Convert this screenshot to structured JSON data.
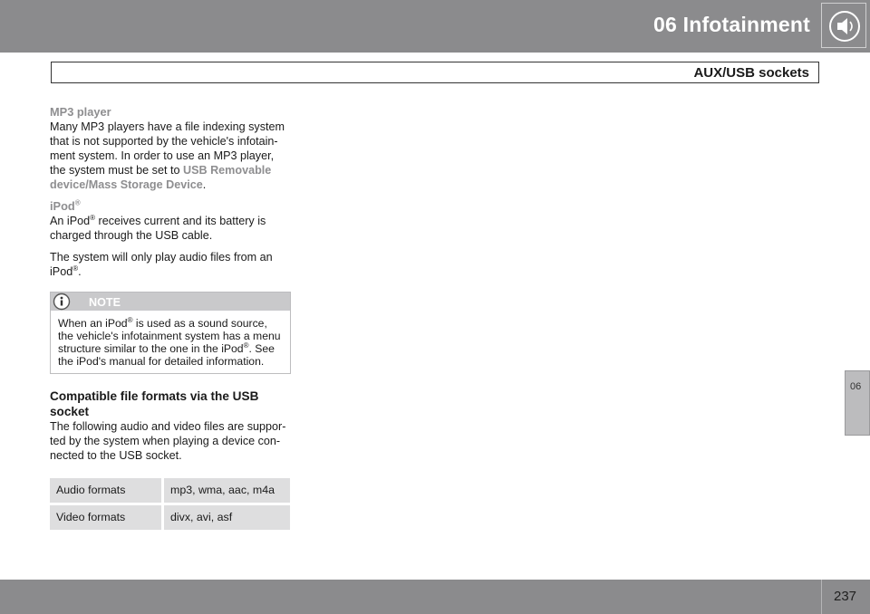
{
  "header": {
    "chapter_title": "06  Infotainment",
    "section_title": "AUX/USB sockets"
  },
  "mp3": {
    "heading": "MP3 player",
    "text_1": "Many MP3 players have a file indexing system that is not supported by the vehicle's infotain-ment system. In order to use an MP3 player, the system must be set to ",
    "link": "USB Removable device/Mass Storage Device",
    "text_2": "."
  },
  "ipod": {
    "heading": "iPod",
    "reg": "®",
    "p1_a": "An iPod",
    "p1_b": " receives current and its battery is charged through the USB cable.",
    "p2_a": "The system will only play audio files from an iPod",
    "p2_b": "."
  },
  "note": {
    "label": "NOTE",
    "text_a": "When an iPod",
    "text_b": " is used as a sound source, the vehicle's infotainment system has a menu structure similar to the one in the iPod",
    "text_c": ". See the iPod's manual for detailed information."
  },
  "compat": {
    "heading": "Compatible file formats via the USB socket",
    "text": "The following audio and video files are suppor-ted by the system when playing a device con-nected to the USB socket."
  },
  "formats": [
    {
      "label": "Audio formats",
      "value": "mp3, wma, aac, m4a"
    },
    {
      "label": "Video formats",
      "value": "divx, avi, asf"
    }
  ],
  "side_tab": "06",
  "page_number": "237",
  "icons": {
    "header_icon": "speaker-icon",
    "note_icon": "info-icon"
  },
  "colors": {
    "bar": "#8b8b8d",
    "accent_text": "#8e8e90",
    "table_bg": "#dededf"
  }
}
